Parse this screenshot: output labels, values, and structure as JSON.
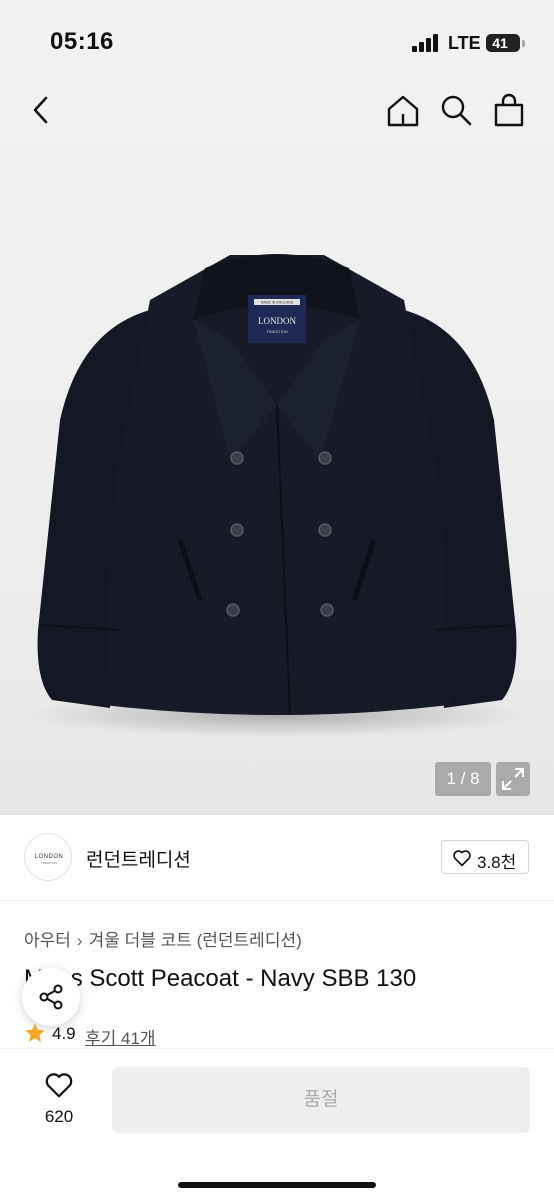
{
  "status_bar": {
    "time": "05:16",
    "network": "LTE",
    "battery": "41"
  },
  "nav": {
    "icons": [
      "back-icon",
      "home-icon",
      "search-icon",
      "shopping-bag-icon"
    ]
  },
  "gallery": {
    "counter": "1 / 8",
    "current": 1,
    "total": 8,
    "label_top": "MADE IN ENGLAND",
    "label_brand": "LONDON",
    "label_sub": "TRADITION"
  },
  "brand": {
    "name": "런던트레디션",
    "logo_text": "LONDON",
    "logo_sub": "TRADITION",
    "likes": "3.8천"
  },
  "breadcrumb": {
    "category": "아우터",
    "subcategory": "겨울 더블 코트 (런던트레디션)"
  },
  "product": {
    "title": "Mens Scott Peacoat - Navy SBB 130",
    "rating": "4.9",
    "reviews": "후기 41개"
  },
  "bottom": {
    "wish_count": "620",
    "cta_label": "품절"
  },
  "colors": {
    "accent_star": "#f5a623",
    "coat": "#161a25",
    "soldout_bg": "#eeeeee"
  }
}
